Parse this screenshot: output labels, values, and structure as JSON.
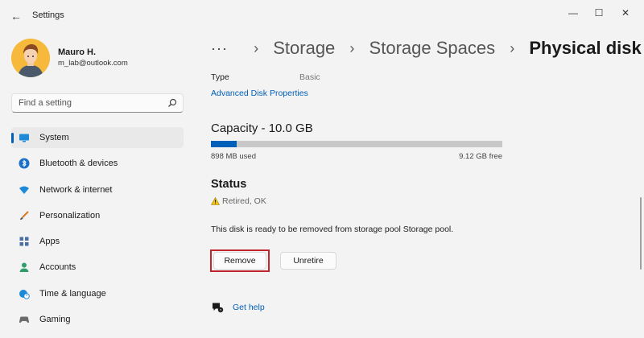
{
  "window": {
    "title": "Settings",
    "controls": {
      "minimize": "—",
      "maximize": "☐",
      "close": "✕"
    },
    "back": "←"
  },
  "user": {
    "name": "Mauro H.",
    "email": "m_lab@outlook.com"
  },
  "search": {
    "placeholder": "Find a setting"
  },
  "sidebar": {
    "items": [
      {
        "label": "System",
        "icon": "monitor-icon",
        "active": true
      },
      {
        "label": "Bluetooth & devices",
        "icon": "bluetooth-icon"
      },
      {
        "label": "Network & internet",
        "icon": "wifi-icon"
      },
      {
        "label": "Personalization",
        "icon": "brush-icon"
      },
      {
        "label": "Apps",
        "icon": "apps-icon"
      },
      {
        "label": "Accounts",
        "icon": "person-icon"
      },
      {
        "label": "Time & language",
        "icon": "clock-globe-icon"
      },
      {
        "label": "Gaming",
        "icon": "controller-icon"
      }
    ]
  },
  "breadcrumb": {
    "overflow": "···",
    "separator": "›",
    "items": [
      "Storage",
      "Storage Spaces"
    ],
    "current": "Physical disk"
  },
  "details": {
    "type_label": "Type",
    "type_value": "Basic",
    "advanced_link": "Advanced Disk Properties"
  },
  "capacity": {
    "title": "Capacity - 10.0 GB",
    "used_label": "898 MB used",
    "free_label": "9.12 GB free",
    "used_fraction": 0.088,
    "bar_color": "#005fb8"
  },
  "status": {
    "title": "Status",
    "value": "Retired, OK",
    "icon": "warning-icon",
    "message": "This disk is ready to be removed from storage pool Storage pool."
  },
  "actions": {
    "remove": "Remove",
    "unretire": "Unretire",
    "highlight_color": "#c2262c"
  },
  "help": {
    "label": "Get help",
    "icon": "help-chat-icon"
  },
  "colors": {
    "accent": "#005fb8",
    "background": "#f3f3f3"
  }
}
